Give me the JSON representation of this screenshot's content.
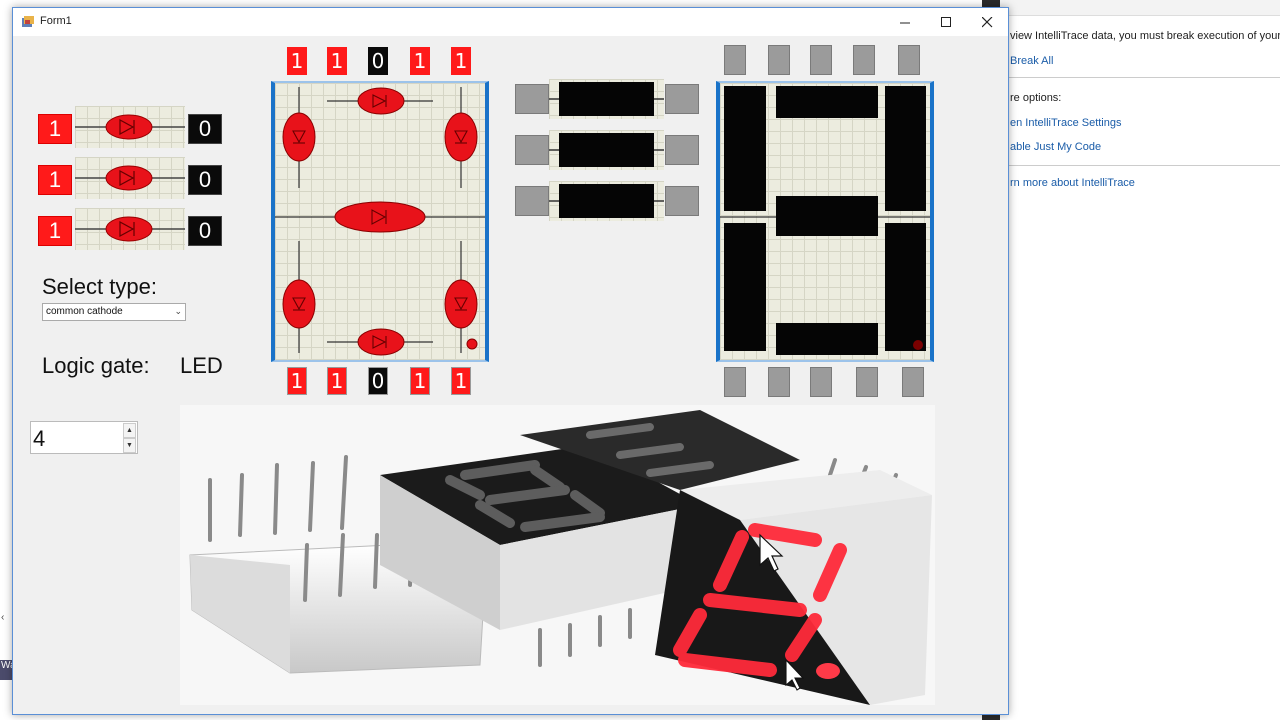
{
  "vs_panel": {
    "line1": "view IntelliTrace data, you must break execution of your a",
    "break_all": "Break All",
    "more_options": "re options:",
    "open_settings": "en IntelliTrace Settings",
    "just_my_code": "able Just My Code",
    "learn_more": "rn more about IntelliTrace",
    "left_label": "Wa"
  },
  "window": {
    "title": "Form1",
    "minimize_icon": "minimize-icon",
    "maximize_icon": "maximize-icon",
    "close_icon": "close-icon"
  },
  "gates": [
    {
      "input": "1",
      "output": "0"
    },
    {
      "input": "1",
      "output": "0"
    },
    {
      "input": "1",
      "output": "0"
    }
  ],
  "select_type_label": "Select type:",
  "select_type_value": "common cathode",
  "logic_gate_label": "Logic gate:",
  "logic_gate_value": "LED",
  "spin_value": "4",
  "segment_bits_top": [
    "1",
    "1",
    "0",
    "1",
    "1"
  ],
  "segment_bits_bottom": [
    "1",
    "1",
    "0",
    "1",
    "1"
  ],
  "colors": {
    "on_red": "#ff1a1a",
    "off_black": "#0a0a0a",
    "led_red": "#e8121a",
    "gray": "#9b9b9b",
    "accent_blue": "#1a73c8"
  }
}
